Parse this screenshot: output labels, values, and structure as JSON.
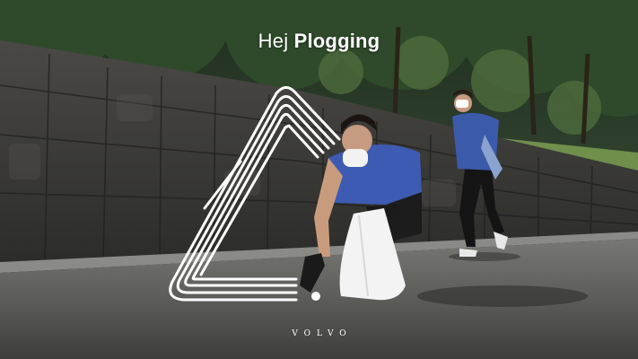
{
  "headline": {
    "greeting": "Hej",
    "emphasis": "Plogging"
  },
  "brand": {
    "wordmark": "VOLVO"
  },
  "colors": {
    "text": "#ffffff",
    "shirt": "#3a56a8",
    "road": "#555555",
    "wall": "#3c3c3a"
  },
  "icons": [
    "triangle-line-logo",
    "volvo-wordmark"
  ]
}
